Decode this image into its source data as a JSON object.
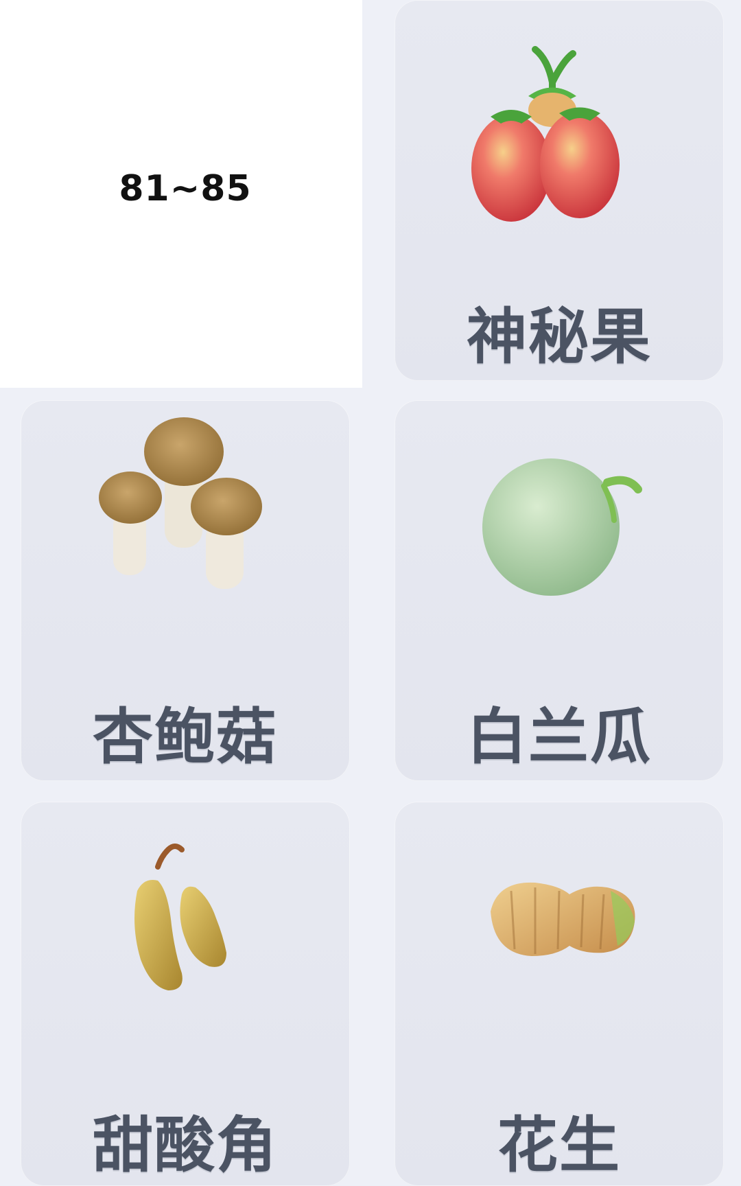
{
  "range": {
    "label": "81~85"
  },
  "items": [
    {
      "name": "神秘果",
      "icon": "miracle-fruit-icon"
    },
    {
      "name": "杏鲍菇",
      "icon": "king-oyster-mushroom-icon"
    },
    {
      "name": "白兰瓜",
      "icon": "honeydew-melon-icon"
    },
    {
      "name": "甜酸角",
      "icon": "tamarind-icon"
    },
    {
      "name": "花生",
      "icon": "peanut-icon"
    }
  ],
  "colors": {
    "background": "#eef0f7",
    "card": "#e5e7ef",
    "label_text": "#4b5363",
    "range_text": "#111111"
  }
}
